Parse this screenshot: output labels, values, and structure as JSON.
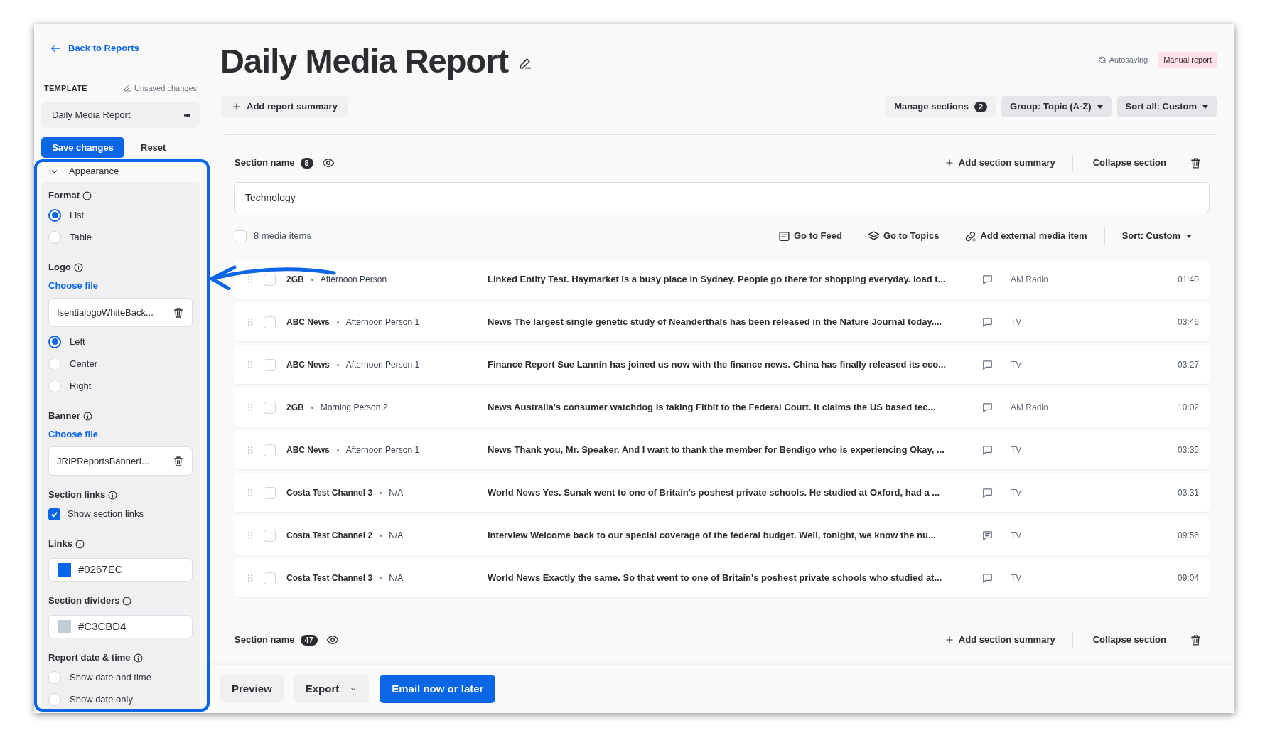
{
  "sidebar": {
    "back_link": "Back to Reports",
    "template_label": "TEMPLATE",
    "unsaved_label": "Unsaved changes",
    "template_name": "Daily Media Report",
    "more_button": "•••",
    "save_button": "Save changes",
    "reset_button": "Reset",
    "panel_title": "Appearance",
    "settings": [
      {
        "label": "Format",
        "kind": "radio",
        "options": [
          {
            "label": "List",
            "selected": true
          },
          {
            "label": "Table",
            "selected": false
          }
        ]
      },
      {
        "label": "Logo",
        "kind": "file",
        "link": "Choose file",
        "file_name": "IsentialogoWhiteBack...",
        "options": [
          {
            "label": "Left",
            "selected": true
          },
          {
            "label": "Center",
            "selected": false
          },
          {
            "label": "Right",
            "selected": false
          }
        ]
      },
      {
        "label": "Banner",
        "kind": "file",
        "link": "Choose file",
        "file_name": "JRIPReportsBannerI..."
      },
      {
        "label": "Section links",
        "kind": "checkbox",
        "option": "Show section links",
        "checked": true
      },
      {
        "label": "Links",
        "kind": "color",
        "value": "#0267EC",
        "color": "#0267ec"
      },
      {
        "label": "Section dividers",
        "kind": "color",
        "value": "#C3CBD4",
        "color": "#c3cbd4"
      },
      {
        "label": "Report date & time",
        "kind": "radio",
        "options": [
          {
            "label": "Show date and time",
            "selected": false
          },
          {
            "label": "Show date only",
            "selected": false
          }
        ]
      }
    ]
  },
  "header": {
    "title": "Daily Media Report",
    "autosaving": "Autosaving",
    "badge": "Manual report",
    "add_summary": "Add report summary",
    "manage_sections": "Manage sections",
    "sections_count": "2",
    "group": "Group: Topic (A-Z)",
    "sort_all": "Sort all: Custom"
  },
  "sections": [
    {
      "name_label": "Section name",
      "count": "8",
      "add_summary": "Add section summary",
      "collapse": "Collapse section",
      "name_value": "Technology",
      "items_count": "8 media items",
      "all_checked": false,
      "actions": [
        {
          "kind": "feed",
          "label": "Go to Feed"
        },
        {
          "kind": "topics",
          "label": "Go to Topics"
        },
        {
          "kind": "link",
          "label": "Add external media item"
        }
      ],
      "sort": "Sort: Custom",
      "rows": [
        {
          "source": "2GB",
          "person": "Afternoon Person",
          "summary": "Linked Entity Test. Haymarket is a busy place in Sydney. People go there for shopping everyday. load t...",
          "has_comment": false,
          "checked": false,
          "media_type": "AM Radio",
          "duration": "01:40"
        },
        {
          "source": "ABC News",
          "person": "Afternoon Person 1",
          "summary": "News The largest single genetic study of Neanderthals has been released in the Nature Journal today....",
          "has_comment": false,
          "checked": false,
          "media_type": "TV",
          "duration": "03:46"
        },
        {
          "source": "ABC News",
          "person": "Afternoon Person 1",
          "summary": "Finance Report Sue Lannin has joined us now with the finance news. China has finally released its eco...",
          "has_comment": false,
          "checked": false,
          "media_type": "TV",
          "duration": "03:27"
        },
        {
          "source": "2GB",
          "person": "Morning Person 2",
          "summary": "News Australia's **consumer watchdog** is taking Fitbit to the Federal Court. It claims the US based tec...",
          "has_comment": false,
          "checked": false,
          "media_type": "AM Radio",
          "duration": "10:02"
        },
        {
          "source": "ABC News",
          "person": "Afternoon Person 1",
          "summary": "News Thank you, Mr. Speaker. And I want to thank the member for Bendigo who is experiencing Okay, ...",
          "has_comment": false,
          "checked": false,
          "media_type": "TV",
          "duration": "03:35"
        },
        {
          "source": "Costa Test Channel 3",
          "person": "N/A",
          "summary": "World News Yes. Sunak went to one of Britain's poshest private schools. He **studied** at Oxford, had a ...",
          "has_comment": false,
          "checked": false,
          "media_type": "TV",
          "duration": "03:31"
        },
        {
          "source": "Costa Test Channel 2",
          "person": "N/A",
          "summary": "Interview Welcome back to our special coverage of the federal budget. Well, tonight, we know the nu...",
          "has_comment": true,
          "checked": false,
          "media_type": "TV",
          "duration": "09:56"
        },
        {
          "source": "Costa Test Channel 3",
          "person": "N/A",
          "summary": "World News Exactly the same. So that went to one of Britain's poshest private schools who **studied** at...",
          "has_comment": false,
          "checked": false,
          "media_type": "TV",
          "duration": "09:04"
        }
      ]
    },
    {
      "name_label": "Section name",
      "count": "47",
      "add_summary": "Add section summary",
      "collapse": "Collapse section"
    }
  ],
  "footer": {
    "preview": "Preview",
    "export": "Export",
    "email": "Email now or later"
  }
}
